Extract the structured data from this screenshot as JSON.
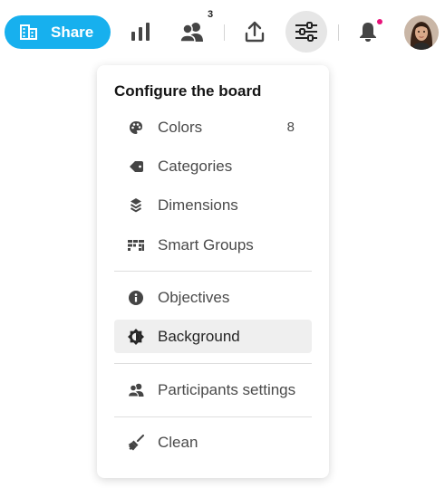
{
  "toolbar": {
    "share_label": "Share",
    "participants_count": "3",
    "icons": {
      "share": "grid-board-icon",
      "stats": "bar-chart-icon",
      "participants": "people-icon",
      "export": "upload-icon",
      "configure": "sliders-icon",
      "notifications": "bell-icon"
    },
    "accent_color": "#17b0ee",
    "notification_dot_color": "#e8127a"
  },
  "menu": {
    "title": "Configure the board",
    "items": [
      {
        "label": "Colors",
        "count": "8",
        "icon": "palette-icon"
      },
      {
        "label": "Categories",
        "icon": "tag-icon"
      },
      {
        "label": "Dimensions",
        "icon": "layers-icon"
      },
      {
        "label": "Smart Groups",
        "icon": "smart-groups-icon"
      },
      {
        "label": "Objectives",
        "icon": "info-icon"
      },
      {
        "label": "Background",
        "icon": "brightness-icon",
        "active": true
      },
      {
        "label": "Participants settings",
        "icon": "people-icon"
      },
      {
        "label": "Clean",
        "icon": "broom-icon"
      }
    ]
  }
}
